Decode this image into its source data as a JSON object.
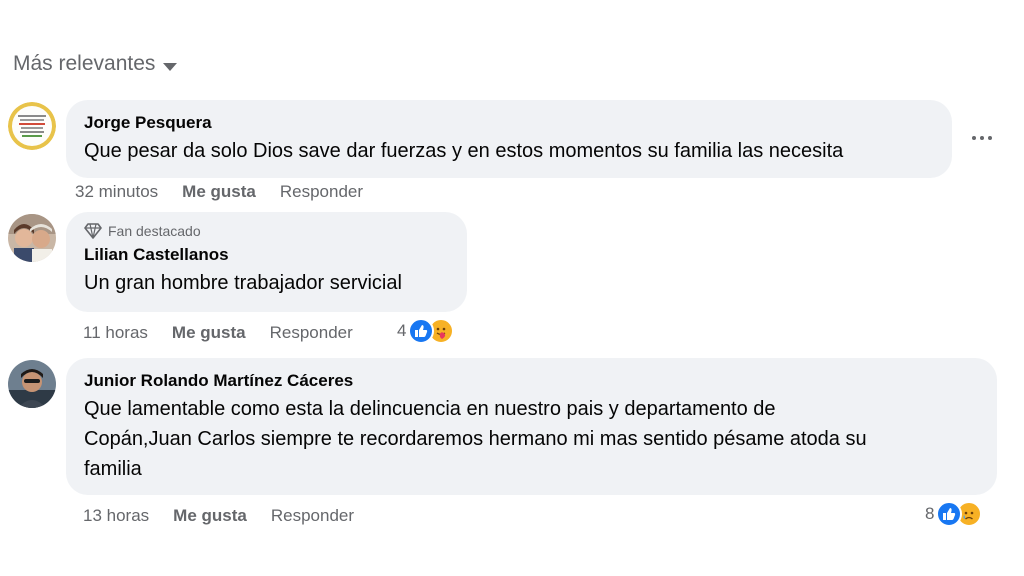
{
  "sort": {
    "label": "Más relevantes",
    "icon": "caret-down-icon"
  },
  "comments": [
    {
      "author": "Jorge Pesquera",
      "text": "Que pesar da solo Dios save dar fuerzas y en estos momentos su familia las necesita",
      "time": "32 minutos",
      "like_label": "Me gusta",
      "reply_label": "Responder"
    },
    {
      "badge": "Fan destacado",
      "author": "Lilian Castellanos",
      "text": "Un gran hombre trabajador servicial",
      "time": "11 horas",
      "like_label": "Me gusta",
      "reply_label": "Responder",
      "reaction_count": "4",
      "reactions": [
        "like",
        "care"
      ]
    },
    {
      "author": "Junior Rolando Martínez Cáceres",
      "text_lines": [
        "Que lamentable como esta la delincuencia en nuestro pais y departamento de",
        "Copán,Juan Carlos siempre te recordaremos hermano mi mas sentido pésame atoda su",
        "familia"
      ],
      "time": "13 horas",
      "like_label": "Me gusta",
      "reply_label": "Responder",
      "reaction_count": "8",
      "reactions": [
        "like",
        "sad"
      ]
    }
  ],
  "colors": {
    "bubble": "#f0f2f5",
    "secondary_text": "#65676b",
    "like_blue": "#1877f2",
    "emoji_yellow": "#f7b125"
  }
}
